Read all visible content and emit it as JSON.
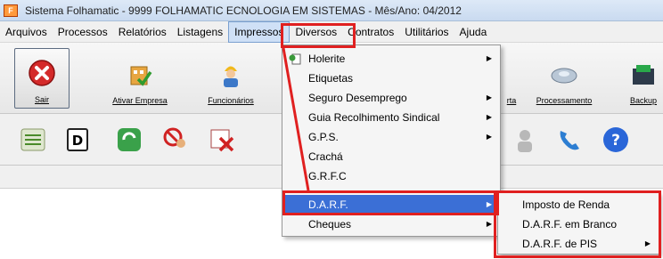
{
  "window": {
    "title": "Sistema Folhamatic - 9999 FOLHAMATIC ECNOLOGIA EM SISTEMAS - Mês/Ano: 04/2012",
    "app_icon": "F"
  },
  "menubar": {
    "items": [
      "Arquivos",
      "Processos",
      "Relatórios",
      "Listagens",
      "Impressos",
      "Diversos",
      "Contratos",
      "Utilitários",
      "Ajuda"
    ],
    "active": "Impressos"
  },
  "toolbar": {
    "sair": "Sair",
    "ativar_empresa": "Ativar Empresa",
    "funcionarios": "Funcionários",
    "rta": "rta",
    "processamento": "Processamento",
    "backup": "Backup"
  },
  "impressos_menu": {
    "holerite": "Holerite",
    "etiquetas": "Etiquetas",
    "seguro_desemprego": "Seguro Desemprego",
    "guia_recolhimento": "Guia Recolhimento Sindical",
    "gps": "G.P.S.",
    "cracha": "Crachá",
    "grfc": "G.R.F.C",
    "darf": "D.A.R.F.",
    "cheques": "Cheques"
  },
  "darf_submenu": {
    "imposto_renda": "Imposto de Renda",
    "darf_branco": "D.A.R.F. em Branco",
    "darf_pis": "D.A.R.F. de PIS"
  },
  "colors": {
    "highlight": "#e02020",
    "selection": "#3b6fd6"
  }
}
